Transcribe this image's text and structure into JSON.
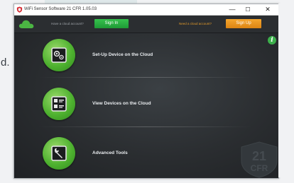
{
  "page": {
    "side_letter": "d."
  },
  "window": {
    "title": "WiFi Sensor Software 21 CFR 1.05.03",
    "minimize_glyph": "—",
    "maximize_glyph": "☐",
    "close_glyph": "✕"
  },
  "topbar": {
    "have_account_text": "Have a cloud account?",
    "signin_label": "Sign In",
    "need_account_text": "Need a cloud account?",
    "signup_label": "Sign Up"
  },
  "menu": {
    "items": [
      {
        "label": "Set-Up Device on the Cloud",
        "icon": "device-setup-icon"
      },
      {
        "label": "View Devices on the Cloud",
        "icon": "devices-list-icon"
      },
      {
        "label": "Advanced Tools",
        "icon": "tools-icon"
      }
    ]
  },
  "info": {
    "glyph": "i"
  },
  "watermark": {
    "text_line1": "21",
    "text_line2": "CFR"
  },
  "colors": {
    "accent_green": "#3cb04b",
    "accent_orange": "#e8941f",
    "window_bg": "#25282b"
  }
}
